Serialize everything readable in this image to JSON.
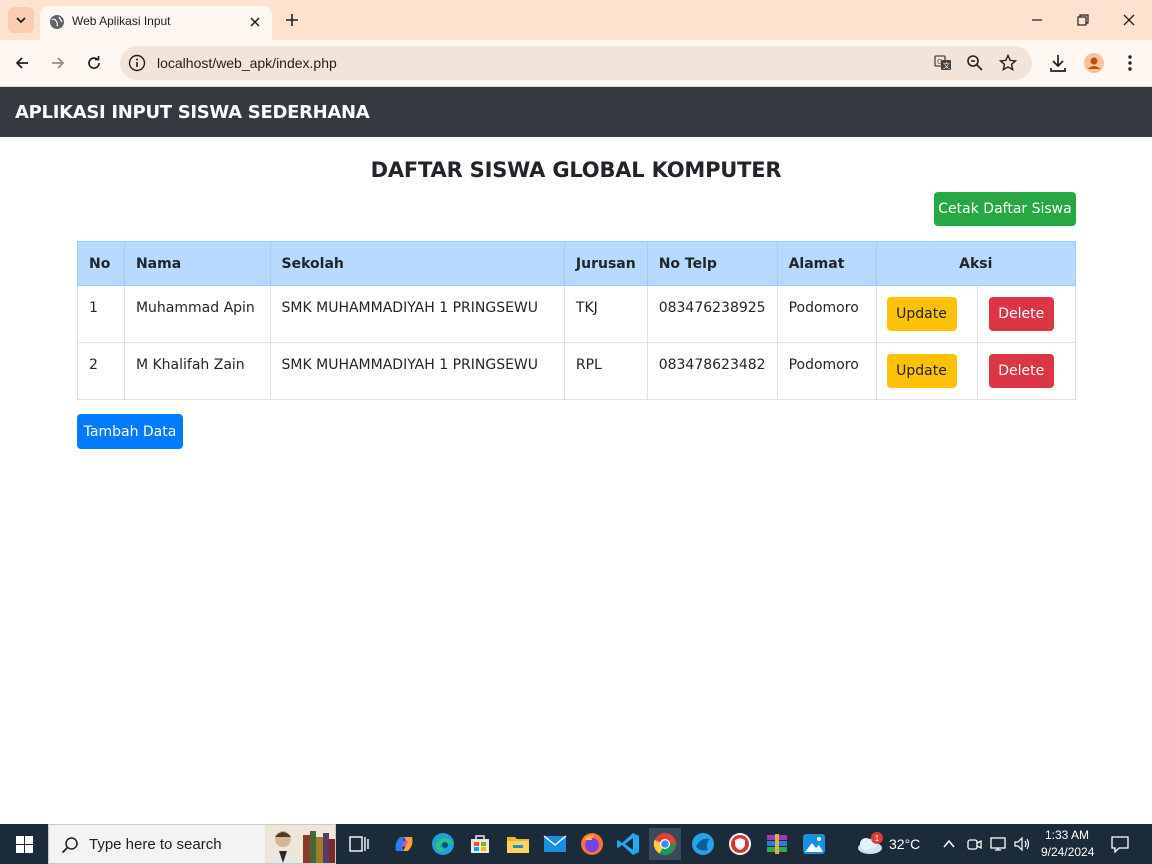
{
  "browser": {
    "tab_title": "Web Aplikasi Input",
    "url": "localhost/web_apk/index.php"
  },
  "app": {
    "brand": "APLIKASI INPUT SISWA SEDERHANA",
    "page_title": "DAFTAR SISWA GLOBAL KOMPUTER",
    "print_button": "Cetak Daftar Siswa",
    "add_button": "Tambah Data",
    "table": {
      "headers": [
        "No",
        "Nama",
        "Sekolah",
        "Jurusan",
        "No Telp",
        "Alamat",
        "Aksi"
      ],
      "rows": [
        {
          "no": "1",
          "nama": "Muhammad Apin",
          "sekolah": "SMK MUHAMMADIYAH 1 PRINGSEWU",
          "jurusan": "TKJ",
          "telp": "083476238925",
          "alamat": "Podomoro",
          "update": "Update",
          "delete": "Delete"
        },
        {
          "no": "2",
          "nama": "M Khalifah Zain",
          "sekolah": "SMK MUHAMMADIYAH 1 PRINGSEWU",
          "jurusan": "RPL",
          "telp": "083478623482",
          "alamat": "Podomoro",
          "update": "Update",
          "delete": "Delete"
        }
      ]
    }
  },
  "taskbar": {
    "search_placeholder": "Type here to search",
    "weather": "32°C",
    "weather_badge": "1",
    "time": "1:33 AM",
    "date": "9/24/2024"
  },
  "colors": {
    "navbar": "#343a40",
    "table_header": "#b8daff",
    "success": "#28a745",
    "primary": "#007bff",
    "warning": "#ffc107",
    "danger": "#dc3545",
    "chrome_frame": "#fde2cf"
  }
}
